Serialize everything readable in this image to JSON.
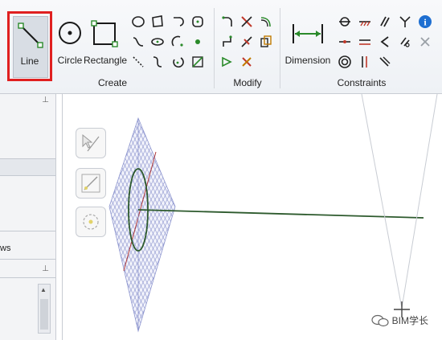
{
  "ribbon": {
    "groups": {
      "create": "Create",
      "modify": "Modify",
      "constraints": "Constraints"
    },
    "buttons": {
      "line": "Line",
      "circle": "Circle",
      "rectangle": "Rectangle",
      "dimension": "Dimension"
    }
  },
  "left_panel": {
    "truncated_label": "ws"
  },
  "viewport": {
    "toolbar_icons": [
      "select-icon",
      "sketch-line-icon",
      "rotate-icon"
    ]
  },
  "watermark": {
    "text": "BIM学长"
  },
  "colors": {
    "highlight": "#e02020",
    "grid": "#8e96cf",
    "sketch_line": "#2d5a2d"
  }
}
